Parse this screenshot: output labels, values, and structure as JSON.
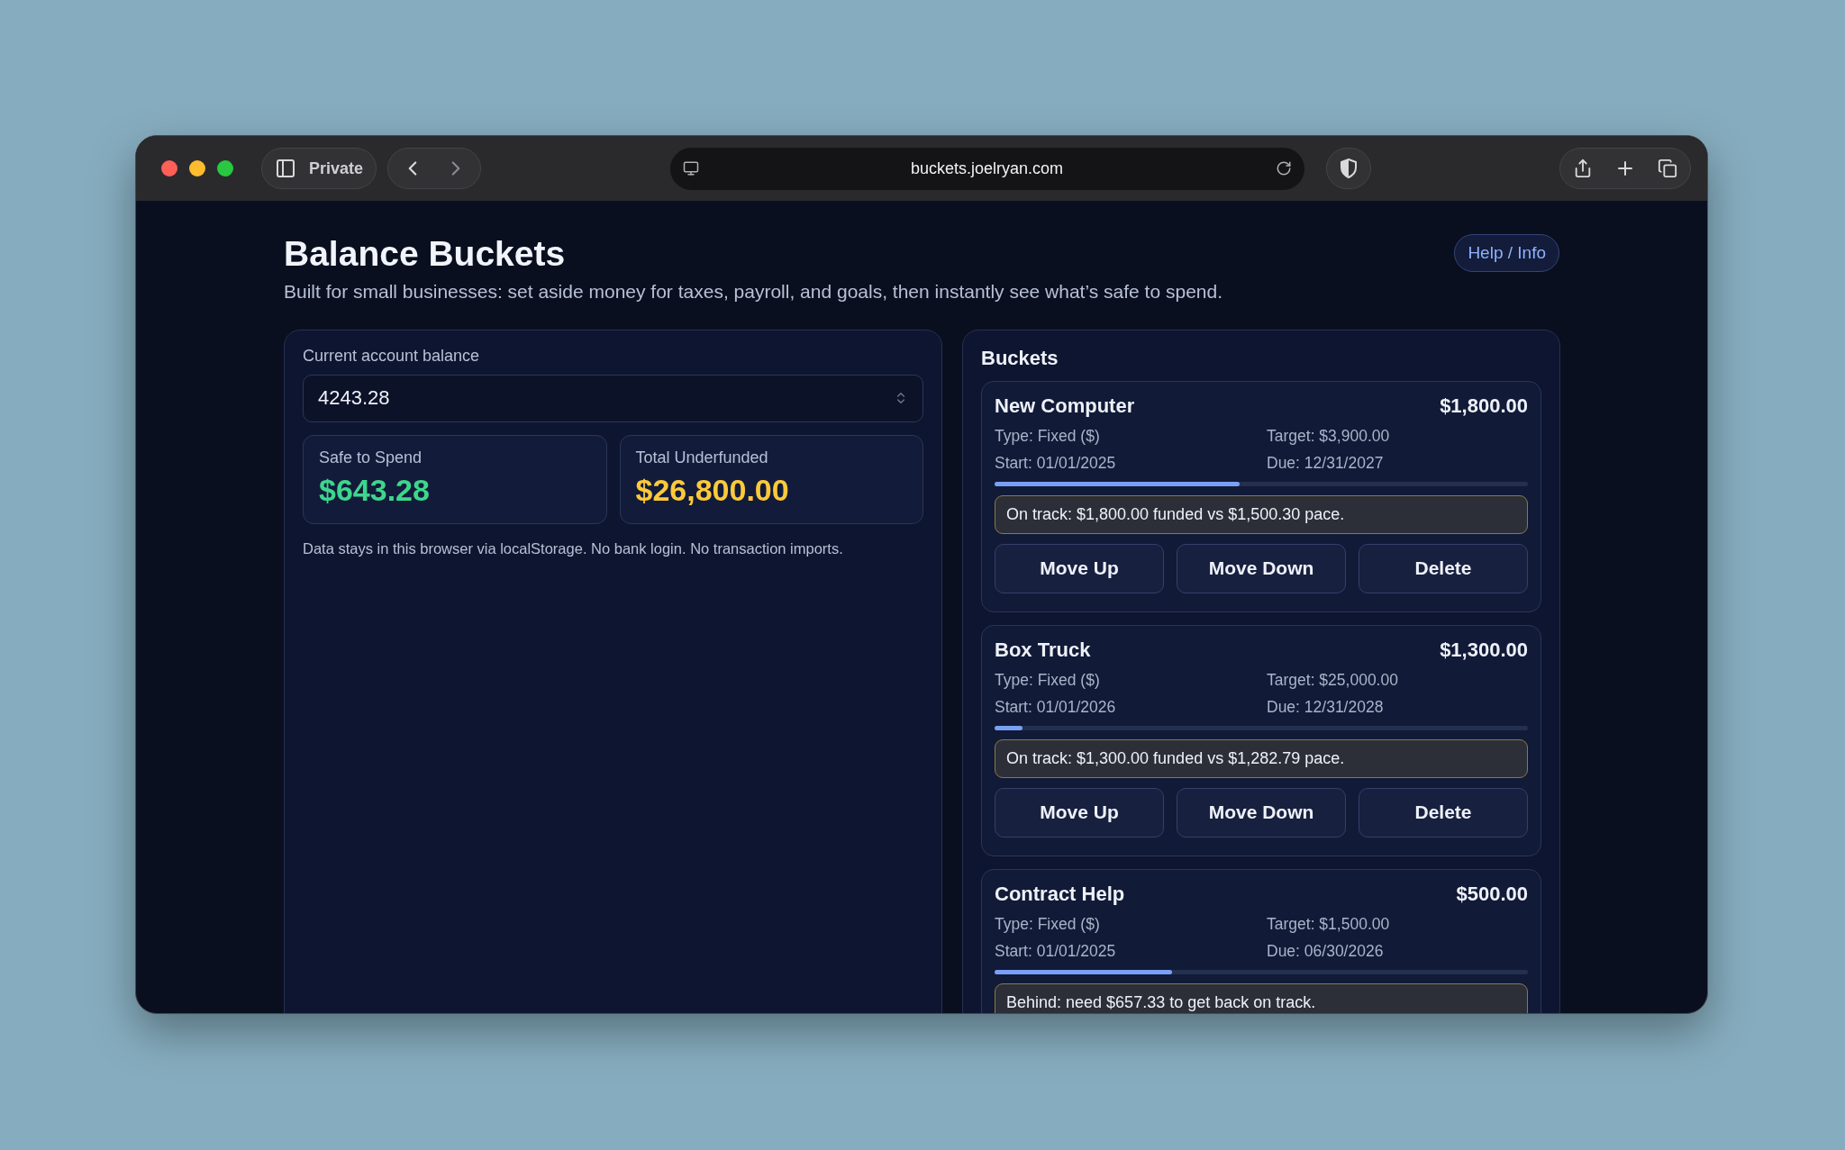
{
  "browser": {
    "private_label": "Private",
    "url": "buckets.joelryan.com"
  },
  "header": {
    "title": "Balance Buckets",
    "subtitle": "Built for small businesses: set aside money for taxes, payroll, and goals, then instantly see what’s safe to spend.",
    "help_button": "Help / Info"
  },
  "balance_panel": {
    "label": "Current account balance",
    "value": "4243.28",
    "stats": [
      {
        "label": "Safe to Spend",
        "value": "$643.28",
        "color": "#3dd68c"
      },
      {
        "label": "Total Underfunded",
        "value": "$26,800.00",
        "color": "#fcc93a"
      }
    ],
    "note": "Data stays in this browser via localStorage. No bank login. No transaction imports."
  },
  "buckets_panel": {
    "title": "Buckets",
    "buckets": [
      {
        "name": "New Computer",
        "amount": "$1,800.00",
        "type": "Type: Fixed ($)",
        "target": "Target: $3,900.00",
        "start": "Start: 01/01/2025",
        "due": "Due: 12/31/2027",
        "level": 0.46,
        "status": "On track: $1,800.00 funded vs $1,500.30 pace.",
        "buttons": [
          "Move Up",
          "Move Down",
          "Delete"
        ]
      },
      {
        "name": "Box Truck",
        "amount": "$1,300.00",
        "type": "Type: Fixed ($)",
        "target": "Target: $25,000.00",
        "start": "Start: 01/01/2026",
        "due": "Due: 12/31/2028",
        "level": 0.052,
        "status": "On track: $1,300.00 funded vs $1,282.79 pace.",
        "buttons": [
          "Move Up",
          "Move Down",
          "Delete"
        ]
      },
      {
        "name": "Contract Help",
        "amount": "$500.00",
        "type": "Type: Fixed ($)",
        "target": "Target: $1,500.00",
        "start": "Start: 01/01/2025",
        "due": "Due: 06/30/2026",
        "level": 0.333,
        "status": "Behind: need $657.33 to get back on track."
      }
    ]
  }
}
